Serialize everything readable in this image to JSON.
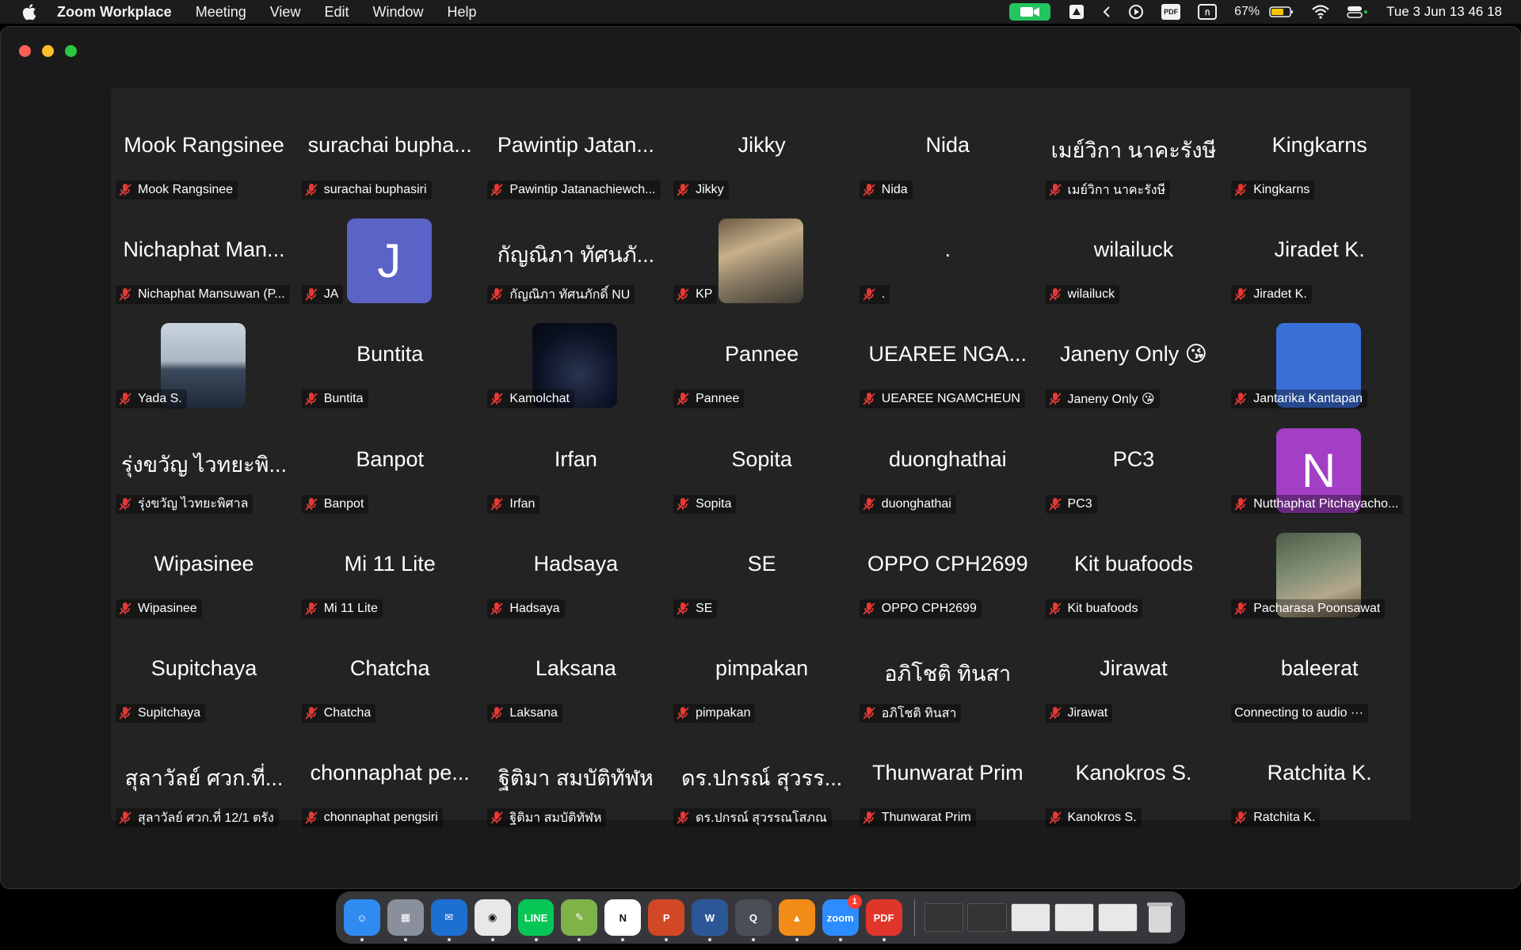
{
  "menubar": {
    "app_name": "Zoom Workplace",
    "menus": [
      "Meeting",
      "View",
      "Edit",
      "Window",
      "Help"
    ],
    "battery": "67%",
    "clock": "Tue 3 Jun  13 46 18"
  },
  "tiles": [
    {
      "name": "Mook Rangsinee",
      "label": "Mook Rangsinee",
      "muted": true
    },
    {
      "name": "surachai bupha...",
      "label": "surachai buphasiri",
      "muted": true
    },
    {
      "name": "Pawintip Jatan...",
      "label": "Pawintip Jatanachiewch...",
      "muted": true
    },
    {
      "name": "Jikky",
      "label": "Jikky",
      "muted": true
    },
    {
      "name": "Nida",
      "label": "Nida",
      "muted": true
    },
    {
      "name": "เมย์วิกา นาคะรังษี",
      "label": "เมย์วิกา นาคะรังษี",
      "muted": true
    },
    {
      "name": "Kingkarns",
      "label": "Kingkarns",
      "muted": true
    },
    {
      "name": "Nichaphat Man...",
      "label": "Nichaphat Mansuwan (P...",
      "muted": true
    },
    {
      "name": "",
      "label": "JA",
      "muted": true,
      "avatar": "J",
      "avatar_color": "#5b63c7"
    },
    {
      "name": "กัญณิภา ทัศนภั...",
      "label": "กัญณิภา ทัศนภักดิ์ NU",
      "muted": true
    },
    {
      "name": "",
      "label": "KP",
      "muted": true,
      "photo": "photo1"
    },
    {
      "name": ".",
      "label": ".",
      "muted": true
    },
    {
      "name": "wilailuck",
      "label": "wilailuck",
      "muted": true
    },
    {
      "name": "Jiradet K.",
      "label": "Jiradet K.",
      "muted": true
    },
    {
      "name": "",
      "label": "Yada S.",
      "muted": true,
      "photo": "photo2"
    },
    {
      "name": "Buntita",
      "label": "Buntita",
      "muted": true
    },
    {
      "name": "",
      "label": "Kamolchat",
      "muted": true,
      "photo": "photo3"
    },
    {
      "name": "Pannee",
      "label": "Pannee",
      "muted": true
    },
    {
      "name": "UEAREE NGA...",
      "label": "UEAREE NGAMCHEUN",
      "muted": true
    },
    {
      "name": "Janeny Only 😘",
      "label": "Janeny Only 😘",
      "muted": true
    },
    {
      "name": "",
      "label": "Jantarika Kantapan",
      "muted": true,
      "avatar": "",
      "avatar_color": "#3b6fd8"
    },
    {
      "name": "รุ่งขวัญ  ไวทยะพิ...",
      "label": "รุ่งขวัญ  ไวทยะพิศาล",
      "muted": true
    },
    {
      "name": "Banpot",
      "label": "Banpot",
      "muted": true
    },
    {
      "name": "Irfan",
      "label": "Irfan",
      "muted": true
    },
    {
      "name": "Sopita",
      "label": "Sopita",
      "muted": true
    },
    {
      "name": "duonghathai",
      "label": "duonghathai",
      "muted": true
    },
    {
      "name": "PC3",
      "label": "PC3",
      "muted": true
    },
    {
      "name": "",
      "label": "Nutthaphat Pitchayacho...",
      "muted": true,
      "avatar": "N",
      "avatar_color": "#a23fc4"
    },
    {
      "name": "Wipasinee",
      "label": "Wipasinee",
      "muted": true
    },
    {
      "name": "Mi 11 Lite",
      "label": "Mi 11 Lite",
      "muted": true
    },
    {
      "name": "Hadsaya",
      "label": "Hadsaya",
      "muted": true
    },
    {
      "name": "SE",
      "label": "SE",
      "muted": true
    },
    {
      "name": "OPPO CPH2699",
      "label": "OPPO CPH2699",
      "muted": true
    },
    {
      "name": "Kit  buafoods",
      "label": "Kit  buafoods",
      "muted": true
    },
    {
      "name": "",
      "label": "Pacharasa  Poonsawat",
      "muted": true,
      "photo": "photo4"
    },
    {
      "name": "Supitchaya",
      "label": "Supitchaya",
      "muted": true
    },
    {
      "name": "Chatcha",
      "label": "Chatcha",
      "muted": true
    },
    {
      "name": "Laksana",
      "label": "Laksana",
      "muted": true
    },
    {
      "name": "pimpakan",
      "label": "pimpakan",
      "muted": true
    },
    {
      "name": "อภิโชติ ทินสา",
      "label": "อภิโชติ ทินสา",
      "muted": true
    },
    {
      "name": "Jirawat",
      "label": "Jirawat",
      "muted": true
    },
    {
      "name": "baleerat",
      "label": "Connecting to audio  ···",
      "muted": false
    },
    {
      "name": "สุลาวัลย์ ศวก.ที่...",
      "label": "สุลาวัลย์ ศวก.ที่ 12/1 ตรัง",
      "muted": true
    },
    {
      "name": "chonnaphat pe...",
      "label": "chonnaphat pengsiri",
      "muted": true
    },
    {
      "name": "ฐิติมา สมบัติทัฬห",
      "label": "ฐิติมา สมบัติทัฬห",
      "muted": true
    },
    {
      "name": "ดร.ปกรณ์ สุวรร...",
      "label": "ดร.ปกรณ์ สุวรรณโสภณ",
      "muted": true
    },
    {
      "name": "Thunwarat Prim",
      "label": "Thunwarat Prim",
      "muted": true
    },
    {
      "name": "Kanokros S.",
      "label": "Kanokros S.",
      "muted": true
    },
    {
      "name": "Ratchita K.",
      "label": "Ratchita K.",
      "muted": true
    }
  ],
  "dock": {
    "apps": [
      {
        "icon": "finder-icon",
        "color": "#2f8bf0",
        "glyph": "☺"
      },
      {
        "icon": "launchpad-icon",
        "color": "#8a8f9c",
        "glyph": "▦"
      },
      {
        "icon": "thunderbird-icon",
        "color": "#1d6fd1",
        "glyph": "✉"
      },
      {
        "icon": "chrome-icon",
        "color": "#e8e8e8",
        "glyph": "◉"
      },
      {
        "icon": "line-icon",
        "color": "#06c755",
        "glyph": "LINE"
      },
      {
        "icon": "notes-icon",
        "color": "#7fb34a",
        "glyph": "✎"
      },
      {
        "icon": "notion-icon",
        "color": "#ffffff",
        "glyph": "N"
      },
      {
        "icon": "powerpoint-icon",
        "color": "#d24726",
        "glyph": "P"
      },
      {
        "icon": "word-icon",
        "color": "#2b5797",
        "glyph": "W"
      },
      {
        "icon": "quicktime-icon",
        "color": "#4a4f57",
        "glyph": "Q"
      },
      {
        "icon": "vlc-icon",
        "color": "#f28c18",
        "glyph": "▲"
      },
      {
        "icon": "zoom-icon",
        "color": "#2d8cff",
        "glyph": "zoom",
        "badge": "1"
      },
      {
        "icon": "pdf-reader-icon",
        "color": "#e0352b",
        "glyph": "PDF"
      }
    ]
  }
}
